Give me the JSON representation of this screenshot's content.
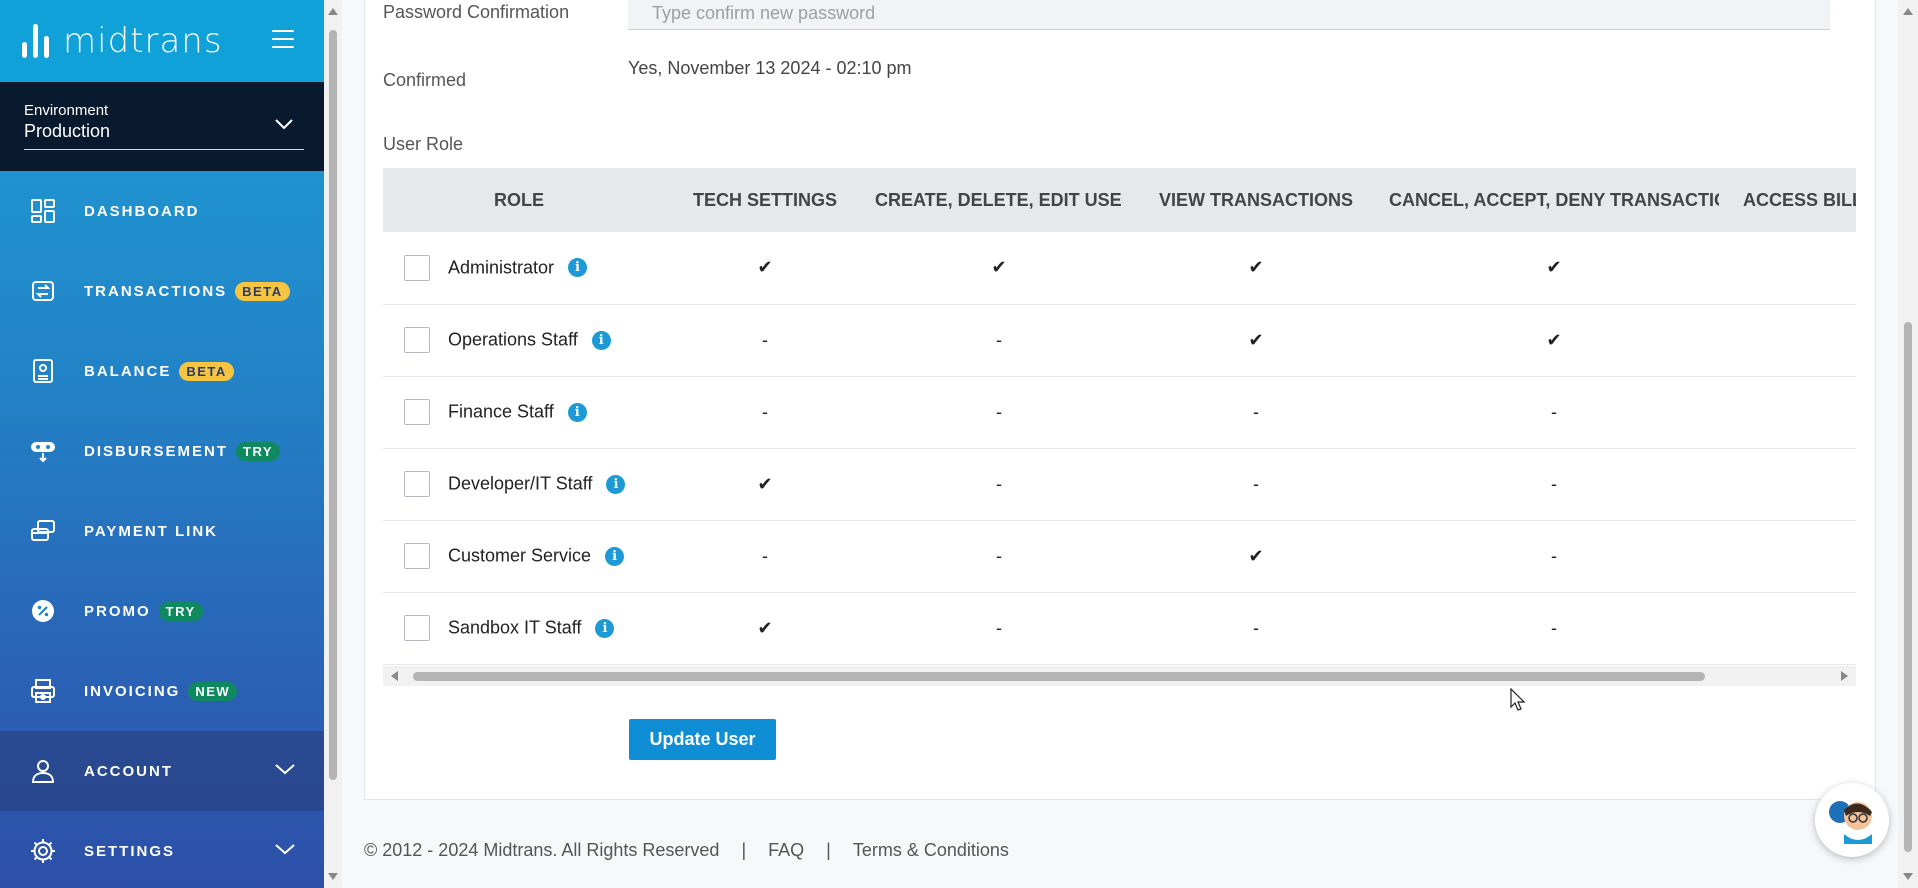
{
  "brand": {
    "name": "midtrans"
  },
  "environment": {
    "label": "Environment",
    "value": "Production"
  },
  "sidebar": {
    "items": [
      {
        "label": "DASHBOARD",
        "icon": "dashboard-icon",
        "badge": ""
      },
      {
        "label": "TRANSACTIONS",
        "icon": "transactions-icon",
        "badge": "BETA"
      },
      {
        "label": "BALANCE",
        "icon": "balance-icon",
        "badge": "BETA"
      },
      {
        "label": "DISBURSEMENT",
        "icon": "disbursement-icon",
        "badge": "TRY"
      },
      {
        "label": "PAYMENT LINK",
        "icon": "payment-link-icon",
        "badge": ""
      },
      {
        "label": "PROMO",
        "icon": "promo-icon",
        "badge": "TRY"
      },
      {
        "label": "INVOICING",
        "icon": "invoicing-icon",
        "badge": "NEW"
      },
      {
        "label": "ACCOUNT",
        "icon": "user-icon",
        "badge": ""
      },
      {
        "label": "SETTINGS",
        "icon": "gear-icon",
        "badge": ""
      }
    ]
  },
  "form": {
    "password_confirmation_label": "Password Confirmation",
    "password_confirmation_placeholder": "Type confirm new password",
    "confirmed_label": "Confirmed",
    "confirmed_value": "Yes, November 13 2024 - 02:10 pm",
    "user_role_label": "User Role",
    "update_button": "Update User"
  },
  "role_table": {
    "headers": [
      "ROLE",
      "TECH SETTINGS",
      "CREATE, DELETE, EDIT USERS",
      "VIEW TRANSACTIONS",
      "CANCEL, ACCEPT, DENY TRANSACTIONS",
      "ACCESS BILLI"
    ],
    "rows": [
      {
        "role": "Administrator",
        "cells": [
          "✔",
          "✔",
          "✔",
          "✔",
          "✔"
        ]
      },
      {
        "role": "Operations Staff",
        "cells": [
          "-",
          "-",
          "✔",
          "✔",
          ""
        ]
      },
      {
        "role": "Finance Staff",
        "cells": [
          "-",
          "-",
          "-",
          "-",
          "✔"
        ]
      },
      {
        "role": "Developer/IT Staff",
        "cells": [
          "✔",
          "-",
          "-",
          "-",
          ""
        ]
      },
      {
        "role": "Customer Service",
        "cells": [
          "-",
          "-",
          "✔",
          "-",
          ""
        ]
      },
      {
        "role": "Sandbox IT Staff",
        "cells": [
          "✔",
          "-",
          "-",
          "-",
          ""
        ]
      }
    ]
  },
  "footer": {
    "copyright": "© 2012 - 2024 Midtrans. All Rights Reserved",
    "faq": "FAQ",
    "terms": "Terms & Conditions",
    "separator": "|"
  },
  "colors": {
    "brand": "#0fa1d8",
    "button": "#0f8ed6",
    "badge_beta": "#f5c542",
    "badge_try": "#0f8a5f"
  }
}
